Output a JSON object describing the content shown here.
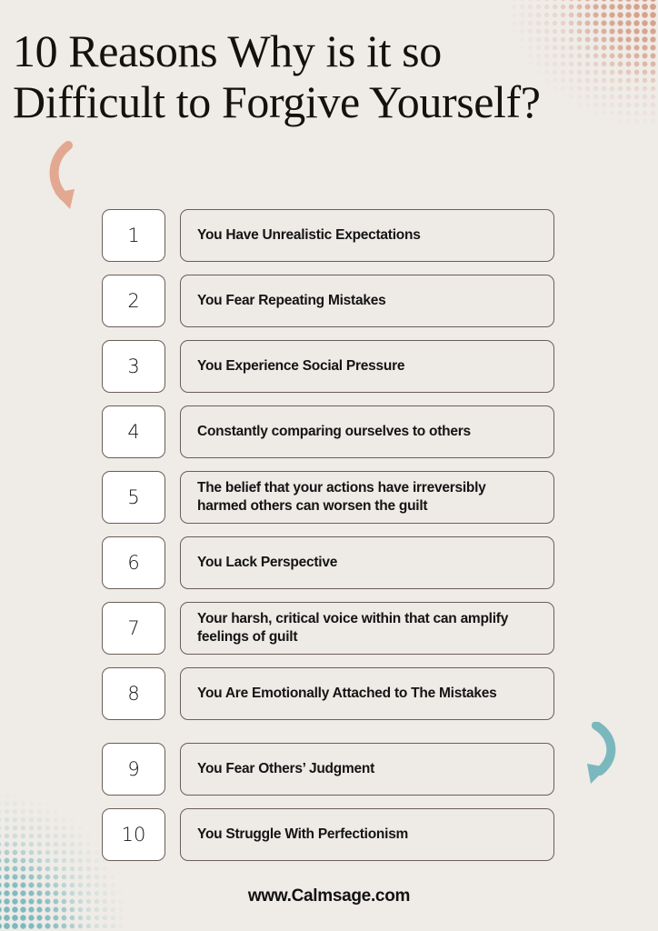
{
  "theme": {
    "background_color": "#efebe7",
    "accent_salmon": "#d7a08b",
    "accent_teal": "#7ab8bd",
    "text_color": "#141414",
    "border_color": "#6b5e58",
    "number_box_fill": "#ffffff",
    "text_box_fill": "#eeeae6"
  },
  "title": "10 Reasons Why is it so\nDifficult to Forgive Yourself?",
  "decorations": {
    "top_right_halftone": "halftone-dots-salmon",
    "bottom_left_halftone": "halftone-dots-teal",
    "arrow_top_left": "curved-arrow-down-right-salmon",
    "arrow_bottom_right": "curved-arrow-down-left-teal"
  },
  "reasons": [
    {
      "number": "1",
      "text": "You Have Unrealistic Expectations"
    },
    {
      "number": "2",
      "text": "You Fear Repeating Mistakes"
    },
    {
      "number": "3",
      "text": "You Experience Social Pressure"
    },
    {
      "number": "4",
      "text": "Constantly comparing ourselves to others"
    },
    {
      "number": "5",
      "text": "The belief that your actions have irreversibly harmed others can worsen the guilt"
    },
    {
      "number": "6",
      "text": "You Lack Perspective"
    },
    {
      "number": "7",
      "text": "Your harsh, critical voice within that can amplify feelings of guilt"
    },
    {
      "number": "8",
      "text": "You Are Emotionally Attached to The Mistakes"
    },
    {
      "number": "9",
      "text": "You Fear Others’ Judgment"
    },
    {
      "number": "10",
      "text": "You Struggle With Perfectionism"
    }
  ],
  "footer": {
    "website": "www.Calmsage.com"
  }
}
